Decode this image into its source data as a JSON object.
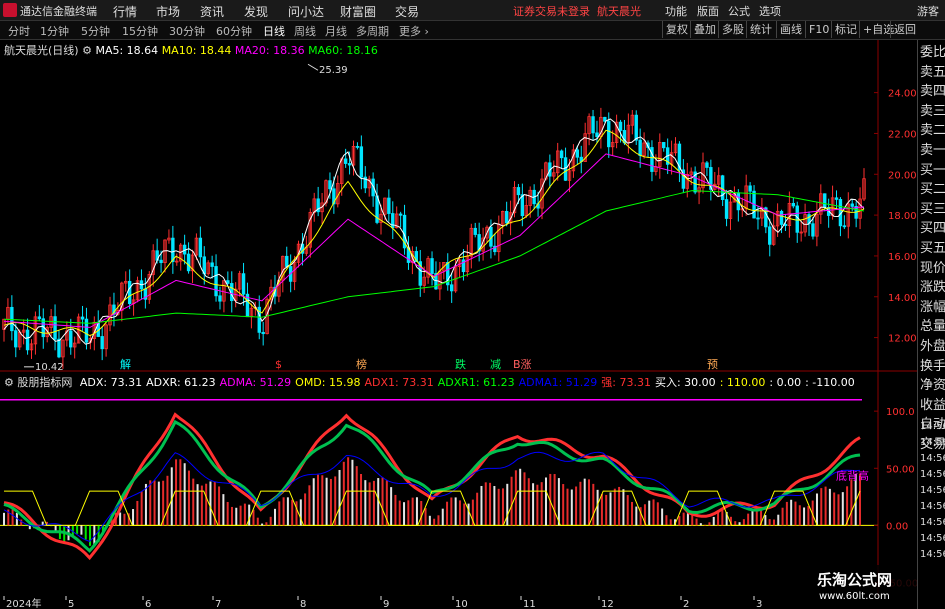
{
  "app": {
    "title": "通达信金融终端",
    "status": "证券交易未登录",
    "stock_name": "航天晨光",
    "guest": "游客"
  },
  "menu": [
    "行情",
    "市场",
    "资讯",
    "发现",
    "问小达",
    "财富圈",
    "交易"
  ],
  "right_menu": [
    "功能",
    "版面",
    "公式",
    "选项"
  ],
  "periods": [
    "分时",
    "1分钟",
    "5分钟",
    "15分钟",
    "30分钟",
    "60分钟",
    "日线",
    "周线",
    "月线",
    "多周期",
    "更多"
  ],
  "active_period": "日线",
  "tools": [
    "复权",
    "叠加",
    "多股",
    "统计",
    "画线",
    "F10",
    "标记",
    "+自选",
    "返回"
  ],
  "price_panel": {
    "title": "航天晨光(日线)",
    "ma": [
      {
        "label": "MA5: 18.64",
        "color": "#ffffff"
      },
      {
        "label": "MA10: 18.44",
        "color": "#ffff00"
      },
      {
        "label": "MA20: 18.36",
        "color": "#ff00ff"
      },
      {
        "label": "MA60: 18.16",
        "color": "#00ff00"
      }
    ],
    "high_label": "25.39",
    "low_label": "10.42",
    "y_ticks": [
      "24.00",
      "22.00",
      "20.00",
      "18.00",
      "16.00",
      "14.00",
      "12.00"
    ],
    "signals": [
      {
        "text": "解",
        "color": "#00ffff"
      },
      {
        "text": "$",
        "color": "#ff3030"
      },
      {
        "text": "榜",
        "color": "#ffaa55"
      },
      {
        "text": "跌",
        "color": "#00ff66"
      },
      {
        "text": "减",
        "color": "#00ff66"
      },
      {
        "text": "B涨",
        "color": "#ff6060"
      },
      {
        "text": "预",
        "color": "#ffaa55"
      }
    ]
  },
  "indicator_panel": {
    "name": "股朋指标网",
    "legend": [
      {
        "label": "ADX: 73.31",
        "color": "#ffffff"
      },
      {
        "label": "ADXR: 61.23",
        "color": "#ffffff"
      },
      {
        "label": "ADMA: 51.29",
        "color": "#ff00ff"
      },
      {
        "label": "OMD: 15.98",
        "color": "#ffff00"
      },
      {
        "label": "ADX1: 73.31",
        "color": "#ff3030"
      },
      {
        "label": "ADXR1: 61.23",
        "color": "#00ff00"
      },
      {
        "label": "ADMA1: 51.29",
        "color": "#0000ff"
      },
      {
        "label": "强: 73.31",
        "color": "#ff3030"
      },
      {
        "label": "买入: 30.00",
        "color": "#ffffff"
      },
      {
        "label": ": 110.00",
        "color": "#ffff00"
      },
      {
        "label": ": 0.00",
        "color": "#ffffff"
      },
      {
        "label": ": -110.00",
        "color": "#ffffff"
      }
    ],
    "y_ticks": [
      "100.0",
      "50.00",
      "0.00",
      "-50.00"
    ],
    "annotation": "底背高"
  },
  "x_axis": [
    "2024年",
    "5",
    "6",
    "7",
    "8",
    "9",
    "10",
    "11",
    "12",
    "2",
    "3"
  ],
  "side_panel": {
    "items": [
      "委比",
      "卖五",
      "卖四",
      "卖三",
      "卖二",
      "卖一",
      "买一",
      "买二",
      "买三",
      "买四",
      "买五",
      "现价",
      "涨跌",
      "涨幅",
      "总量",
      "外盘",
      "换手",
      "净资",
      "收益",
      "自动",
      "交易"
    ],
    "times": [
      "14:56",
      "14:56",
      "14:56",
      "14:56",
      "14:56",
      "14:56",
      "14:56",
      "14:56",
      "14:56"
    ]
  },
  "watermark": {
    "line1": "乐淘公式网",
    "line2": "www.60lt.com"
  },
  "chart_data": [
    {
      "type": "line",
      "title": "航天晨光(日线)",
      "x": [
        "2024年",
        "5",
        "6",
        "7",
        "8",
        "9",
        "10",
        "11",
        "12",
        "2",
        "3"
      ],
      "ylim": [
        11.0,
        25.5
      ],
      "series": [
        {
          "name": "MA5",
          "values": [
            12.4,
            12.0,
            16.6,
            13.0,
            21.0,
            14.5,
            18.5,
            22.5,
            20.0,
            17.5,
            18.6
          ]
        },
        {
          "name": "MA10",
          "values": [
            12.6,
            12.2,
            15.8,
            13.4,
            19.5,
            15.0,
            17.8,
            22.0,
            19.8,
            17.8,
            18.4
          ]
        },
        {
          "name": "MA20",
          "values": [
            12.8,
            12.5,
            14.8,
            13.8,
            17.8,
            15.0,
            17.0,
            21.0,
            19.9,
            18.0,
            18.4
          ]
        },
        {
          "name": "MA60",
          "values": [
            12.9,
            12.7,
            13.2,
            13.0,
            14.0,
            14.5,
            16.0,
            18.2,
            19.2,
            19.0,
            18.2
          ]
        }
      ],
      "annotations": {
        "high": 25.39,
        "low": 10.42
      }
    },
    {
      "type": "line",
      "title": "股朋指标网",
      "x": [
        "2024年",
        "5",
        "6",
        "7",
        "8",
        "9",
        "10",
        "11",
        "12",
        "2",
        "3"
      ],
      "ylim": [
        -60,
        115
      ],
      "series": [
        {
          "name": "ADX",
          "values": [
            20,
            -30,
            100,
            10,
            100,
            20,
            80,
            60,
            10,
            20,
            73.31
          ]
        },
        {
          "name": "ADXR",
          "values": [
            15,
            -20,
            90,
            15,
            90,
            25,
            75,
            55,
            15,
            18,
            61.23
          ]
        },
        {
          "name": "ADMA",
          "values": [
            10,
            -10,
            60,
            20,
            60,
            25,
            60,
            60,
            20,
            20,
            51.29
          ]
        }
      ],
      "reference_lines": [
        110,
        0
      ]
    }
  ]
}
